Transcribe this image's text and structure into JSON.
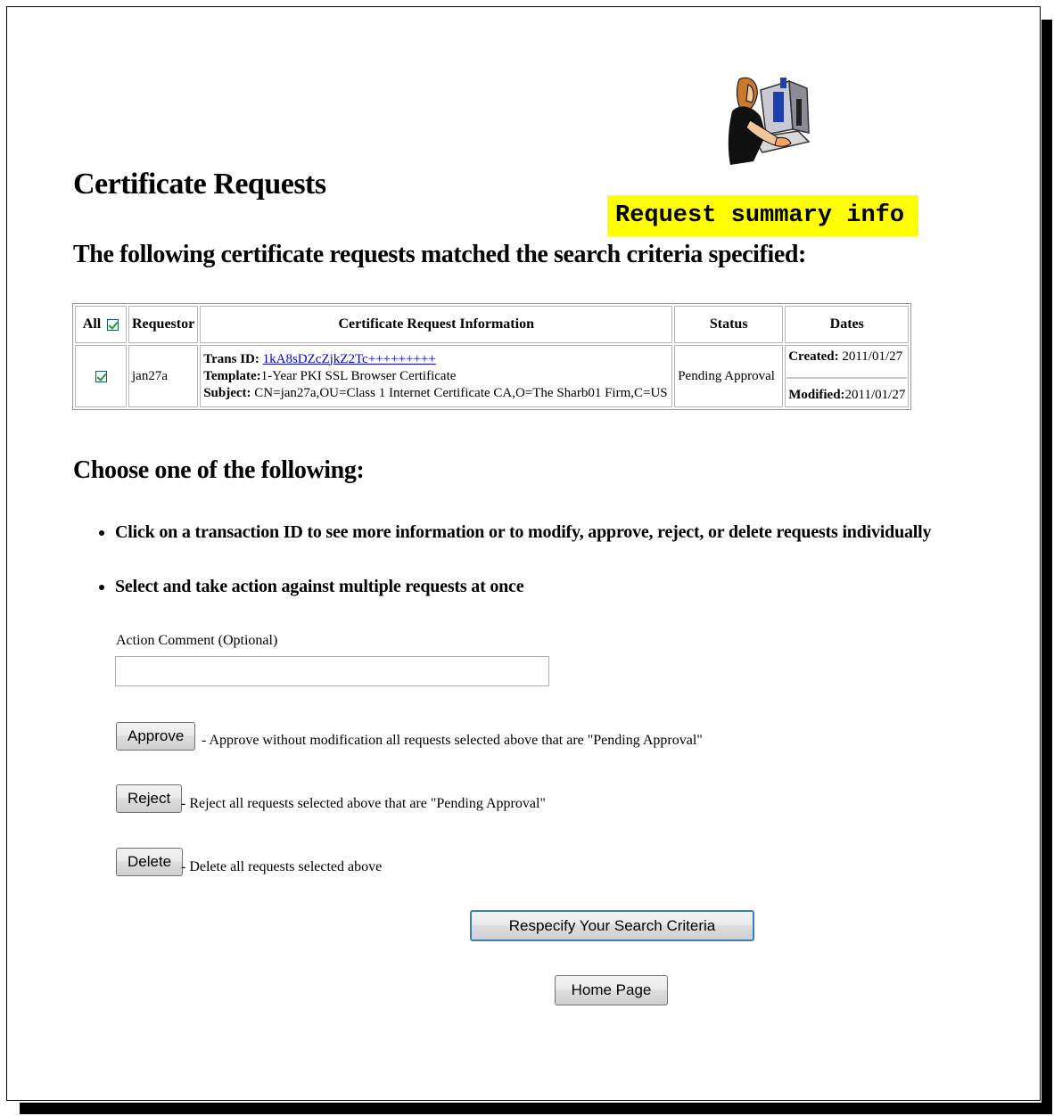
{
  "callout": "Request summary info",
  "title": "Certificate Requests",
  "subtitle": "The following certificate requests matched the search criteria specified:",
  "table": {
    "headers": {
      "all": "All",
      "requestor": "Requestor",
      "info": "Certificate Request Information",
      "status": "Status",
      "dates": "Dates"
    },
    "rows": [
      {
        "checked": true,
        "requestor": "jan27a",
        "trans_label": "Trans ID:",
        "trans_id": "1kA8sDZcZjkZ2Tc+++++++++",
        "template_label": "Template:",
        "template": "1-Year PKI SSL Browser Certificate",
        "subject_label": "Subject:",
        "subject": "CN=jan27a,OU=Class 1 Internet Certificate CA,O=The Sharb01 Firm,C=US",
        "status": "Pending Approval",
        "created_label": "Created:",
        "created": "2011/01/27",
        "modified_label": "Modified:",
        "modified": "2011/01/27"
      }
    ]
  },
  "choose_heading": "Choose one of the following:",
  "options": [
    "Click on a transaction ID to see more information or to modify, approve, reject, or delete requests individually",
    "Select and take action against multiple requests at once"
  ],
  "comment": {
    "label": "Action Comment (Optional)",
    "value": ""
  },
  "actions": {
    "approve_label": "Approve",
    "approve_desc": "- Approve without modification all requests selected above that are \"Pending Approval\"",
    "reject_label": "Reject",
    "reject_desc": "- Reject all requests selected above that are \"Pending Approval\"",
    "delete_label": "Delete",
    "delete_desc": "- Delete all requests selected above",
    "respecify_label": "Respecify Your Search Criteria",
    "home_label": "Home Page"
  },
  "icons": {
    "clipart": "person-at-computer-clipart-icon",
    "checkbox": "checkbox-checked-icon"
  },
  "colors": {
    "callout_bg": "#ffff00",
    "link": "#0000ee",
    "checkmark": "#21a121"
  }
}
